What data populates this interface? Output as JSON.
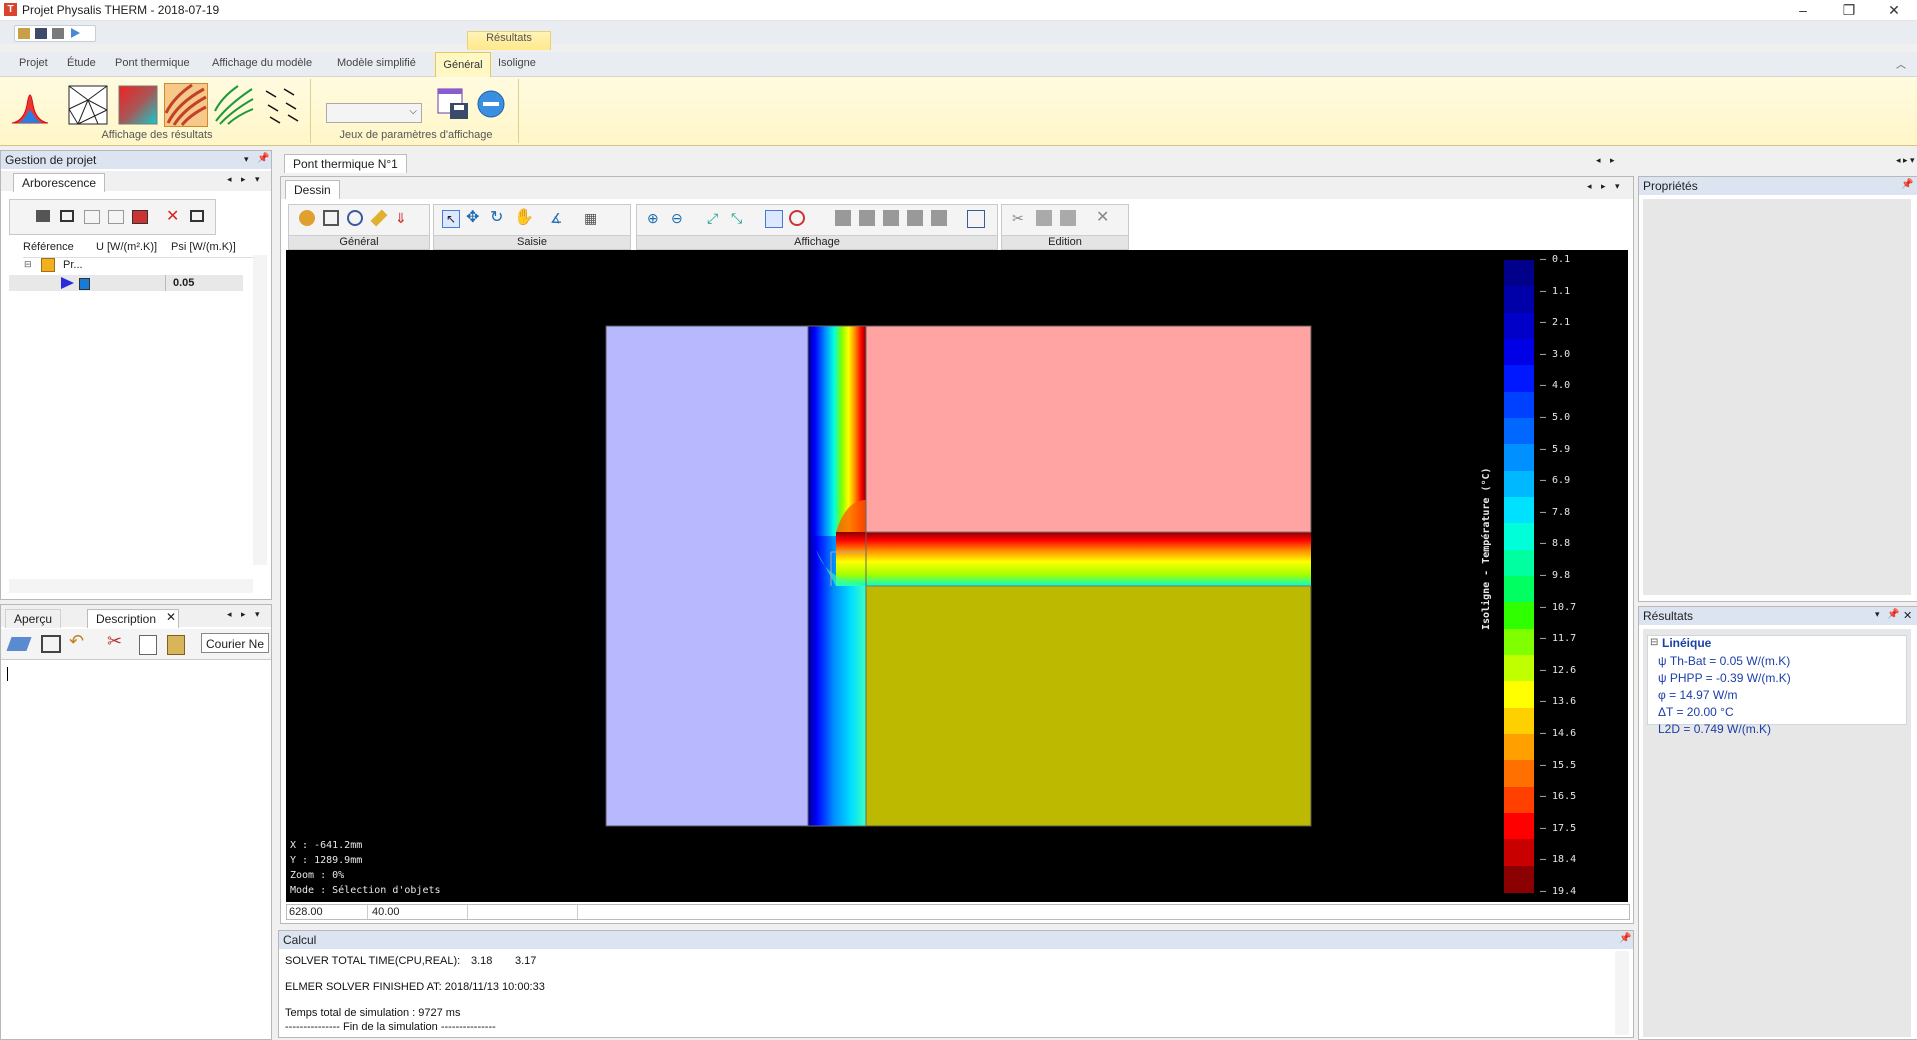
{
  "window": {
    "title": "Projet Physalis THERM - 2018-07-19",
    "app_icon_letter": "T",
    "minimize": "–",
    "restore": "❐",
    "close": "✕"
  },
  "ribbon": {
    "context_label": "Résultats",
    "tabs": [
      "Projet",
      "Étude",
      "Pont thermique",
      "Affichage du modèle",
      "Modèle simplifié",
      "Général",
      "Isoligne"
    ],
    "active_tab": "Général",
    "group1_label": "Affichage des résultats",
    "group2_label": "Jeux de paramètres d'affichage",
    "accent": "#e3c85a"
  },
  "left_panel": {
    "title": "Gestion de projet",
    "tab": "Arborescence",
    "tree_headers": [
      "Référence",
      "U [W/(m².K)]",
      "Psi [W/(m.K)]"
    ],
    "tree_root": "Pr...",
    "tree_child_psi": "0.05"
  },
  "bottom_left": {
    "tabs": [
      "Aperçu",
      "Description"
    ],
    "font_select": "Courier Ne"
  },
  "document": {
    "tab": "Pont thermique N°1",
    "subtab": "Dessin",
    "toolbar_groups": [
      "Général",
      "Saisie",
      "Affichage",
      "Edition"
    ]
  },
  "canvas": {
    "coords": [
      "X    : -641.2mm",
      "Y    : 1289.9mm",
      "Zoom : 0%",
      "Mode : Sélection d'objets"
    ],
    "legend_title": "Isoligne - Température (°C)",
    "legend_values": [
      "0.1",
      "1.1",
      "2.1",
      "3.0",
      "4.0",
      "5.0",
      "5.9",
      "6.9",
      "7.8",
      "8.8",
      "9.8",
      "10.7",
      "11.7",
      "12.6",
      "13.6",
      "14.6",
      "15.5",
      "16.5",
      "17.5",
      "18.4",
      "19.4"
    ],
    "legend_colors": [
      "#00008b",
      "#0000a8",
      "#0000c8",
      "#0000e6",
      "#0018ff",
      "#0040ff",
      "#0068ff",
      "#0090ff",
      "#00b8ff",
      "#00e0ff",
      "#00ffd8",
      "#00ffa0",
      "#00ff60",
      "#30ff00",
      "#80ff00",
      "#c0ff00",
      "#ffff00",
      "#ffd000",
      "#ffa000",
      "#ff7000",
      "#ff4000",
      "#ff0000",
      "#c80000",
      "#8b0000"
    ],
    "status_left": "628.00",
    "status_right": "40.00"
  },
  "properties": {
    "title": "Propriétés"
  },
  "results": {
    "title": "Résultats",
    "section": "Linéique",
    "lines": [
      "ψ Th-Bat = 0.05 W/(m.K)",
      "ψ PHPP  = -0.39 W/(m.K)",
      "φ = 14.97 W/m",
      "ΔT  = 20.00 °C",
      "L2D = 0.749 W/(m.K)"
    ]
  },
  "calcul": {
    "title": "Calcul",
    "line1_label": "SOLVER TOTAL TIME(CPU,REAL):",
    "line1_cpu": "3.18",
    "line1_real": "3.17",
    "line2": "ELMER SOLVER FINISHED AT: 2018/11/13 10:00:33",
    "line3": "Temps total de simulation : 9727 ms",
    "line4": "--------------- Fin de la simulation ---------------"
  }
}
